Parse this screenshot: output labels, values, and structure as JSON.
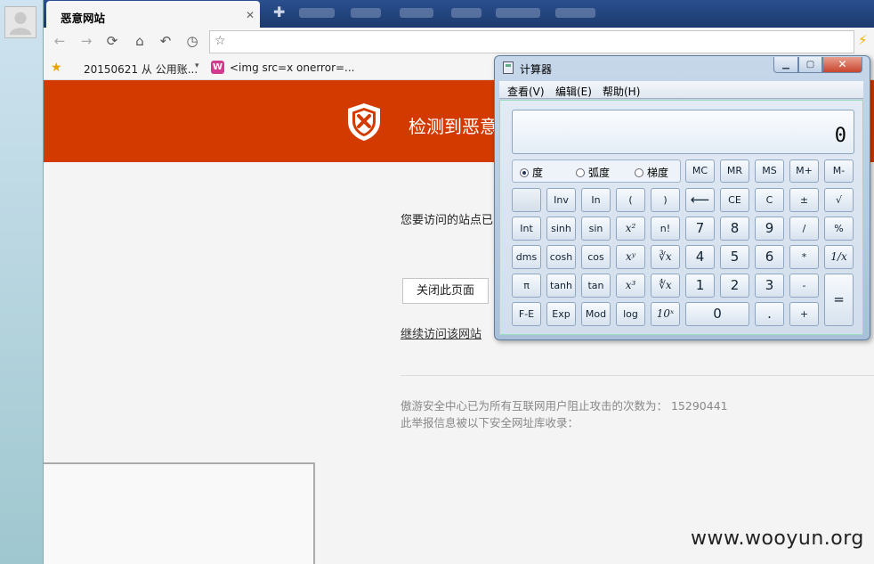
{
  "browser": {
    "tab_title": "恶意网站",
    "tab_close": "✕",
    "new_tab": "✚",
    "url": "",
    "bookmarks": [
      {
        "label": "20150621 从 公用账..."
      },
      {
        "label": "<img src=x onerror=..."
      }
    ]
  },
  "page": {
    "banner_title": "检测到恶意",
    "warning": "您要访问的站点已",
    "close_button": "关闭此页面",
    "continue_link": "继续访问该网站",
    "stats": "傲游安全中心已为所有互联网用户阻止攻击的次数为： 15290441",
    "report": "此举报信息被以下安全网址库收录：",
    "colors": {
      "banner": "#d33a00"
    }
  },
  "watermark": "www.wooyun.org",
  "calculator": {
    "title": "计算器",
    "menus": [
      "查看(V)",
      "编辑(E)",
      "帮助(H)"
    ],
    "display": "0",
    "modes": [
      {
        "label": "度",
        "selected": true
      },
      {
        "label": "弧度",
        "selected": false
      },
      {
        "label": "梯度",
        "selected": false
      }
    ],
    "memory_keys": [
      "MC",
      "MR",
      "MS",
      "M+",
      "M-"
    ],
    "rows": [
      [
        "",
        "Inv",
        "In",
        "(",
        ")",
        "⟵",
        "CE",
        "C",
        "±",
        "√"
      ],
      [
        "Int",
        "sinh",
        "sin",
        "x²",
        "n!",
        "7",
        "8",
        "9",
        "/",
        "%"
      ],
      [
        "dms",
        "cosh",
        "cos",
        "xʸ",
        "∛x",
        "4",
        "5",
        "6",
        "*",
        "1/x"
      ],
      [
        "π",
        "tanh",
        "tan",
        "x³",
        "∜x",
        "1",
        "2",
        "3",
        "-",
        "="
      ],
      [
        "F-E",
        "Exp",
        "Mod",
        "log",
        "10ˣ",
        "0",
        "",
        ".",
        "+",
        ""
      ]
    ]
  }
}
